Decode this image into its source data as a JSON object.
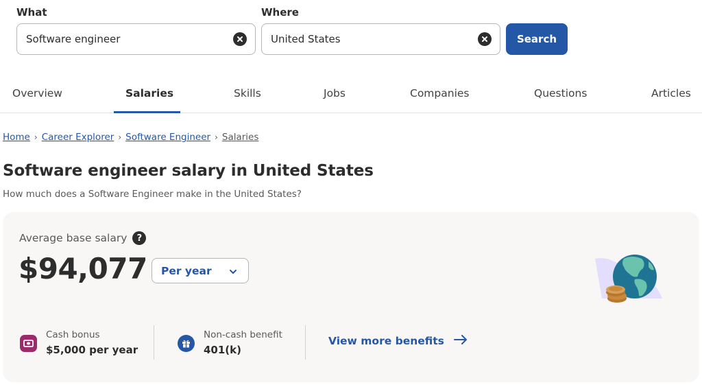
{
  "search": {
    "what_label": "What",
    "what_value": "Software engineer",
    "where_label": "Where",
    "where_value": "United States",
    "button_label": "Search"
  },
  "tabs": [
    {
      "label": "Overview",
      "active": false
    },
    {
      "label": "Salaries",
      "active": true
    },
    {
      "label": "Skills",
      "active": false
    },
    {
      "label": "Jobs",
      "active": false
    },
    {
      "label": "Companies",
      "active": false
    },
    {
      "label": "Questions",
      "active": false
    },
    {
      "label": "Articles",
      "active": false
    }
  ],
  "breadcrumb": {
    "items": [
      "Home",
      "Career Explorer",
      "Software Engineer"
    ],
    "current": "Salaries",
    "separator": "›"
  },
  "page": {
    "title": "Software engineer salary in United States",
    "subtitle": "How much does a Software Engineer make in the United States?"
  },
  "salary_card": {
    "label": "Average base salary",
    "help_glyph": "?",
    "amount": "$94,077",
    "period_selected": "Per year",
    "illustration": "globe-with-coins",
    "benefits": [
      {
        "icon": "cash-icon",
        "label": "Cash bonus",
        "value": "$5,000 per year",
        "color": "#9d2b6b"
      },
      {
        "icon": "gift-icon",
        "label": "Non-cash benefit",
        "value": "401(k)",
        "color": "#2557a7"
      }
    ],
    "more_link": "View more benefits"
  },
  "colors": {
    "accent": "#2557a7",
    "text": "#2d2d2d",
    "muted": "#595959",
    "card_bg": "#f8f7f6",
    "cash_icon_bg": "#9d2b6b"
  }
}
